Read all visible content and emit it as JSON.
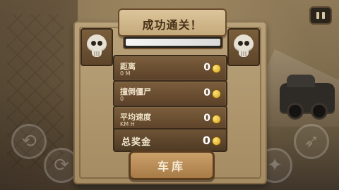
{
  "hud": {
    "pause_icon": "pause-icon"
  },
  "dialog": {
    "title": "成功通关！",
    "progress": 1.0,
    "stats": [
      {
        "label": "距离",
        "unit": "0 M",
        "value": "0",
        "icon": "coin-icon"
      },
      {
        "label": "撞倒僵尸",
        "unit": "0",
        "value": "0",
        "icon": "coin-icon"
      },
      {
        "label": "平均速度",
        "unit": "KM H",
        "value": "0",
        "icon": "coin-icon"
      }
    ],
    "total": {
      "label": "总奖金",
      "value": "0",
      "icon": "coin-icon"
    },
    "primary_button": "车库"
  },
  "decor": {
    "left_emblem": "skull-icon",
    "right_emblem": "skull-icon"
  },
  "controls": {
    "left_a": "rotate-left-icon",
    "left_b": "rotate-right-icon",
    "right_a": "rocket-icon",
    "right_b": "nitro-icon"
  },
  "colors": {
    "panel": "#b9a27a",
    "row": "#6f5436",
    "accent_gold": "#d4a11a"
  }
}
